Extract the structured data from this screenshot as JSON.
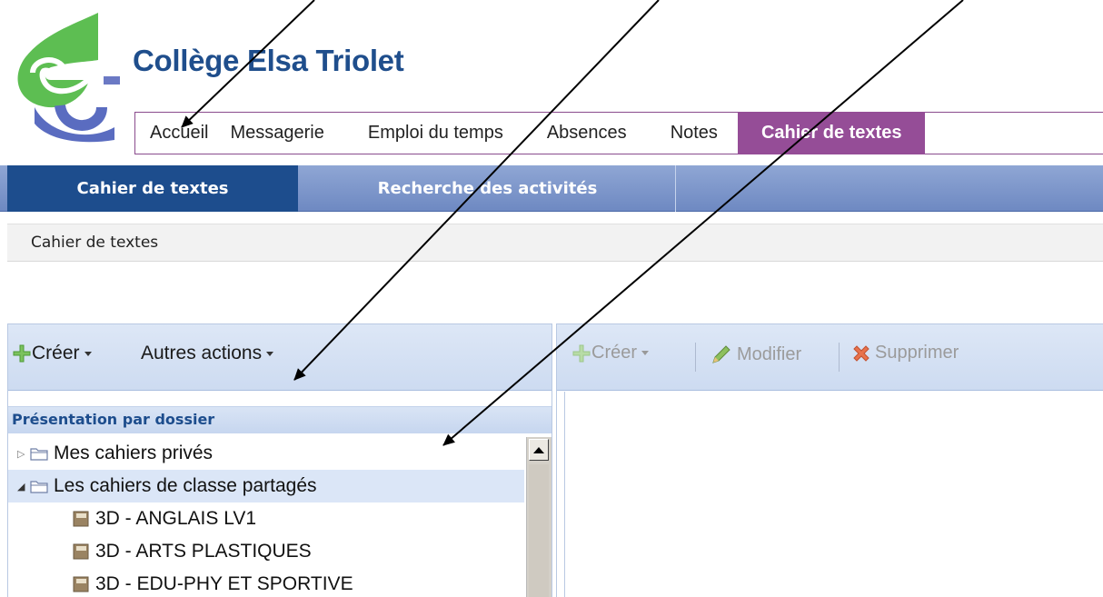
{
  "school": {
    "name": "Collège Elsa Triolet"
  },
  "topmenu": {
    "items": [
      {
        "label": "Accueil"
      },
      {
        "label": "Messagerie"
      },
      {
        "label": "Emploi du temps"
      },
      {
        "label": "Absences"
      },
      {
        "label": "Notes"
      },
      {
        "label": "Cahier de textes"
      }
    ],
    "active_color": "#954d97"
  },
  "subtabs": [
    {
      "label": "Cahier de textes"
    },
    {
      "label": "Recherche des activités"
    }
  ],
  "breadcrumb": "Cahier de textes",
  "left_toolbar": {
    "create_label": "Créer",
    "other_actions_label": "Autres actions"
  },
  "folder_panel": {
    "header": "Présentation par dossier",
    "nodes": [
      {
        "label": "Mes cahiers privés",
        "expanded": false,
        "icon": "folder-icon"
      },
      {
        "label": "Les cahiers de classe partagés",
        "expanded": true,
        "icon": "folder-icon"
      },
      {
        "label": "3D - ANGLAIS LV1",
        "icon": "notebook-icon"
      },
      {
        "label": "3D - ARTS PLASTIQUES",
        "icon": "notebook-icon"
      },
      {
        "label": "3D - EDU-PHY ET SPORTIVE",
        "icon": "notebook-icon"
      }
    ]
  },
  "right_toolbar": {
    "create_label": "Créer",
    "edit_label": "Modifier",
    "delete_label": "Supprimer"
  },
  "colors": {
    "brand_blue": "#1d4d8d",
    "subbar": "#7a93c8",
    "panel_toolbar": "#d6e2f4"
  }
}
